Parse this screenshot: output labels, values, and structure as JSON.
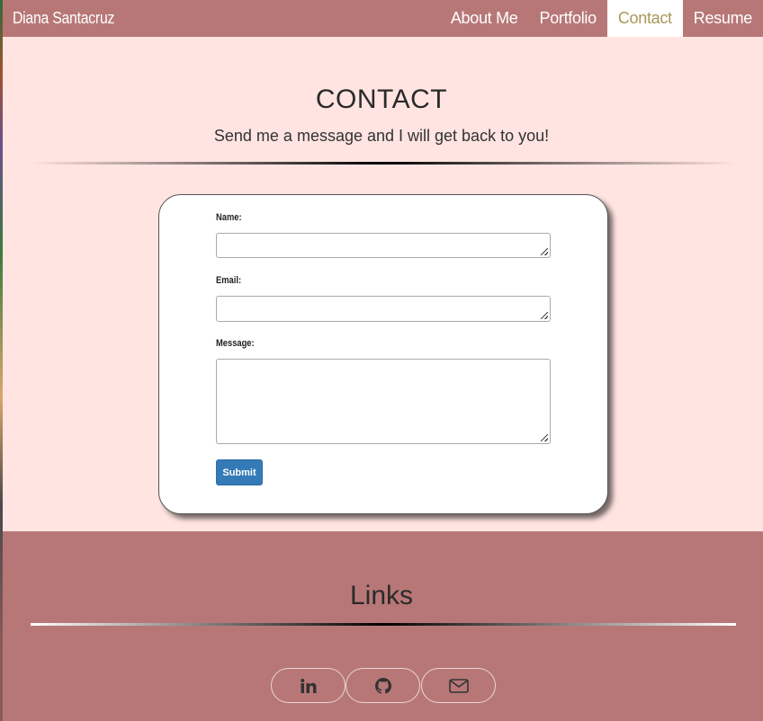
{
  "nav": {
    "brand": "Diana Santacruz",
    "items": [
      {
        "label": "About Me",
        "active": false
      },
      {
        "label": "Portfolio",
        "active": false
      },
      {
        "label": "Contact",
        "active": true
      },
      {
        "label": "Resume",
        "active": false
      }
    ]
  },
  "contact": {
    "title": "CONTACT",
    "subtitle": "Send me a message and I will get back to you!"
  },
  "form": {
    "name_label": "Name:",
    "name_value": "",
    "email_label": "Email:",
    "email_value": "",
    "message_label": "Message:",
    "message_value": "",
    "submit_label": "Submit"
  },
  "footer": {
    "title": "Links",
    "social": [
      {
        "icon": "linkedin-icon"
      },
      {
        "icon": "github-icon"
      },
      {
        "icon": "envelope-icon"
      }
    ]
  },
  "colors": {
    "navbar_bg": "#b87777",
    "page_bg": "#ffe4e1",
    "active_nav_text": "#a8975a",
    "submit_bg": "#337ab7"
  }
}
